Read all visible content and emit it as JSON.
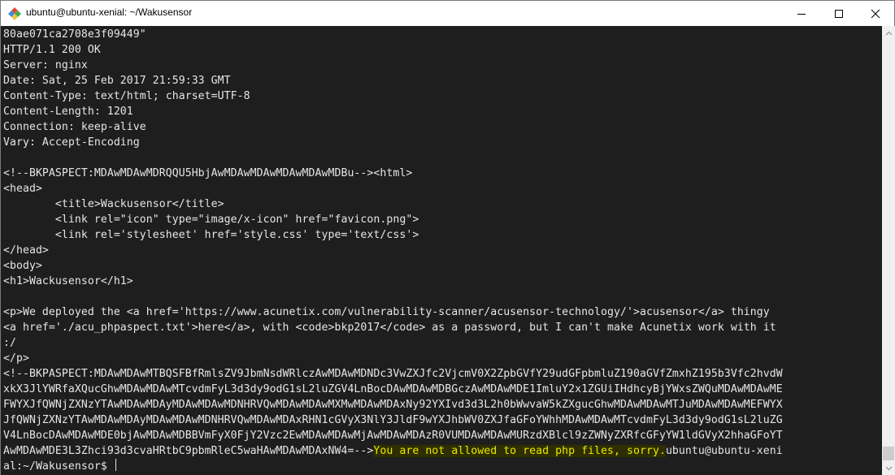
{
  "window": {
    "title": "ubuntu@ubuntu-xenial: ~/Wakusensor",
    "icon": "git-bash-diamond-icon",
    "controls": {
      "minimize": "minimize-icon",
      "maximize": "maximize-icon",
      "close": "close-icon"
    }
  },
  "terminal": {
    "lines": [
      "80ae071ca2708e3f09449\"",
      "HTTP/1.1 200 OK",
      "Server: nginx",
      "Date: Sat, 25 Feb 2017 21:59:33 GMT",
      "Content-Type: text/html; charset=UTF-8",
      "Content-Length: 1201",
      "Connection: keep-alive",
      "Vary: Accept-Encoding",
      "",
      "<!--BKPASPECT:MDAwMDAwMDRQQU5HbjAwMDAwMDAwMDAwMDAwMDBu--><html>",
      "<head>",
      "        <title>Wackusensor</title>",
      "        <link rel=\"icon\" type=\"image/x-icon\" href=\"favicon.png\">",
      "        <link rel='stylesheet' href='style.css' type='text/css'>",
      "</head>",
      "<body>",
      "<h1>Wackusensor</h1>",
      "",
      "<p>We deployed the <a href='https://www.acunetix.com/vulnerability-scanner/acusensor-technology/'>acusensor</a> thingy",
      "<a href='./acu_phpaspect.txt'>here</a>, with <code>bkp2017</code> as a password, but I can't make Acunetix work with it",
      ":/",
      "</p>",
      "<!--BKPASPECT:MDAwMDAwMTBQSFBfRmlsZV9JbmNsdWRlczAwMDAwMDNDc3VwZXJfc2VjcmV0X2ZpbGVfY29udGFpbmluZ190aGVfZmxhZ195b3Vfc2hvdW",
      "xkX3JlYWRfaXQucGhwMDAwMDAwMTcvdmFyL3d3dy9odG1sL2luZGV4LnBocDAwMDAwMDBGczAwMDAwMDE1ImluY2x1ZGUiIHdhcyBjYWxsZWQuMDAwMDAwME",
      "FWYXJfQWNjZXNzYTAwMDAwMDAyMDAwMDAwMDNHRVQwMDAwMDAwMXMwMDAwMDAxNy92YXIvd3d3L2h0bWwvaW5kZXgucGhwMDAwMDAwMTJuMDAwMDAwMEFWYX",
      "JfQWNjZXNzYTAwMDAwMDAyMDAwMDAwMDNHRVQwMDAwMDAxRHN1cGVyX3NlY3JldF9wYXJhbWV0ZXJfaGFoYWhhMDAwMDAwMTcvdmFyL3d3dy9odG1sL2luZG",
      "V4LnBocDAwMDAwMDE0bjAwMDAwMDBBVmFyX0FjY2Vzc2EwMDAwMDAwMjAwMDAwMDAzR0VUMDAwMDAwMURzdXBlcl9zZWNyZXRfcGFyYW1ldGVyX2hhaGFoYT",
      "AwMDAwMDE3L3Zhci93d3cvaHRtbC9pbmRleC5waHAwMDAwMDAxNW4=-->"
    ],
    "highlighted_text": "You are not allowed to read php files, sorry.",
    "prompt_wrap_tail": "ubuntu@ubuntu-xeni",
    "prompt_line": "al:~/Wakusensor$ "
  },
  "colors": {
    "terminal_bg": "#1e1e1e",
    "terminal_fg": "#e6e6e6",
    "highlight_fg": "#e8e800"
  }
}
